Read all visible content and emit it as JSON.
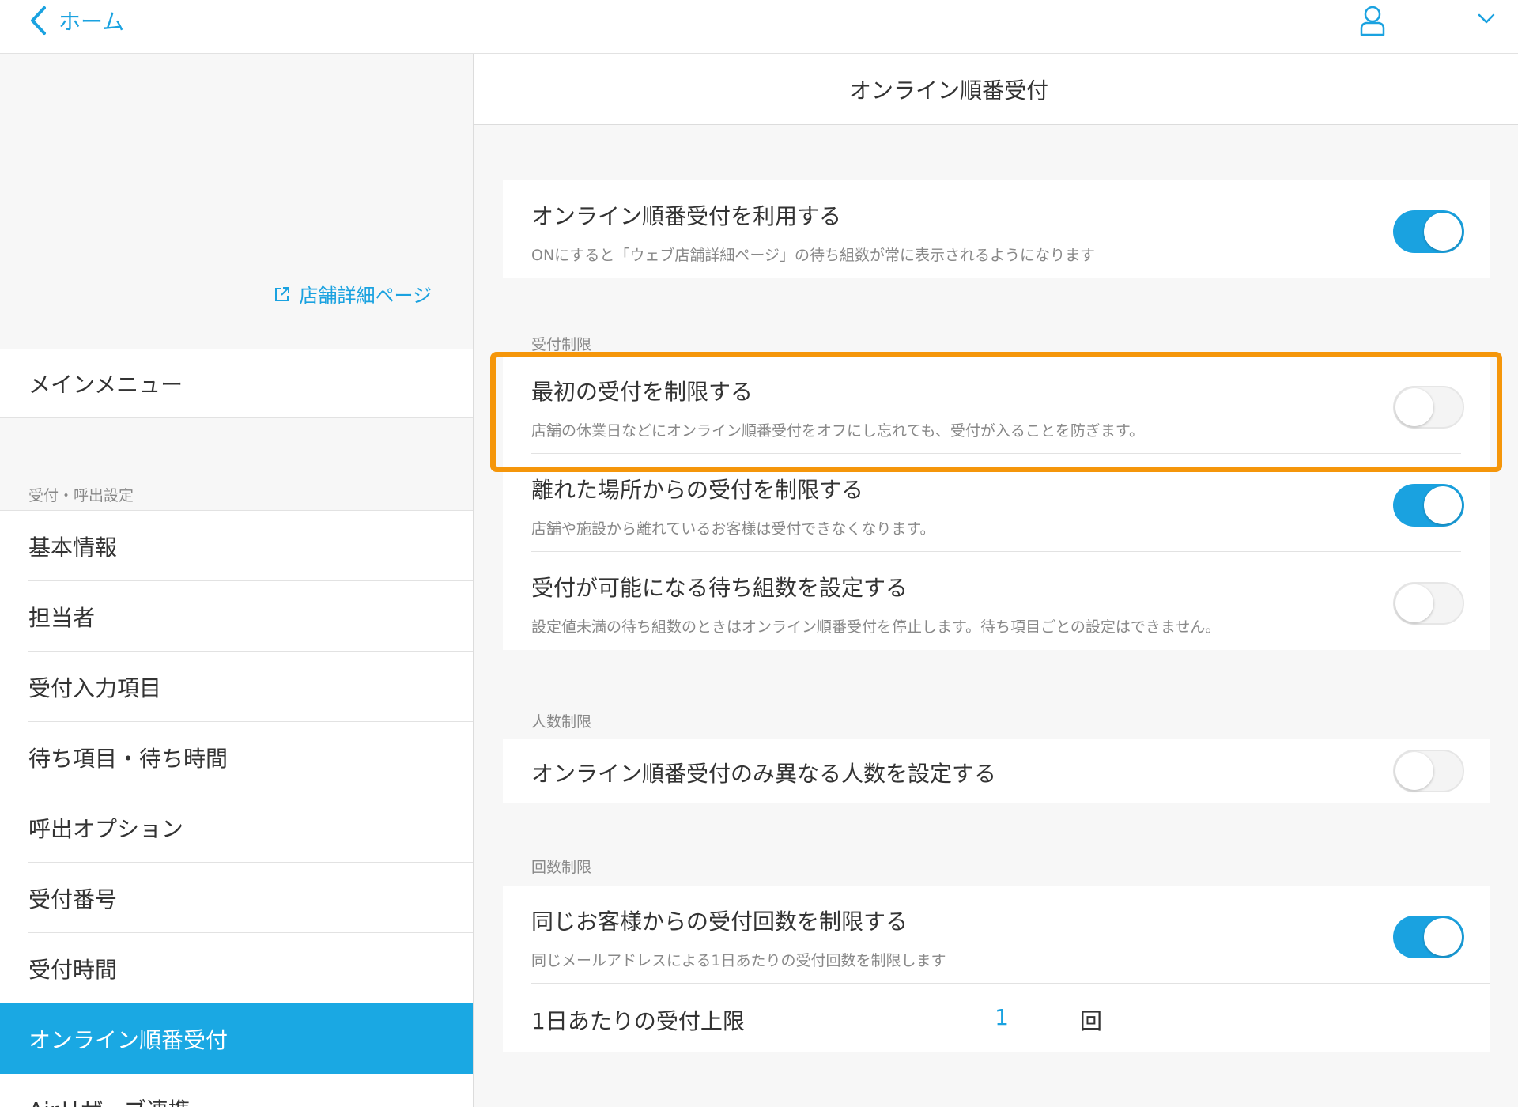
{
  "header": {
    "back_label": "ホーム"
  },
  "sidebar": {
    "store_link_label": "店舗詳細ページ",
    "main_menu_label": "メインメニュー",
    "section_label": "受付・呼出設定",
    "items": [
      {
        "label": "基本情報"
      },
      {
        "label": "担当者"
      },
      {
        "label": "受付入力項目"
      },
      {
        "label": "待ち項目・待ち時間"
      },
      {
        "label": "呼出オプション"
      },
      {
        "label": "受付番号"
      },
      {
        "label": "受付時間"
      },
      {
        "label": "オンライン順番受付"
      },
      {
        "label": "Airリザーブ連携"
      }
    ]
  },
  "main": {
    "title": "オンライン順番受付",
    "use_setting": {
      "title": "オンライン順番受付を利用する",
      "desc": "ONにすると「ウェブ店舗詳細ページ」の待ち組数が常に表示されるようになります",
      "enabled": true
    },
    "reception_limits": {
      "label": "受付制限",
      "rows": [
        {
          "title": "最初の受付を制限する",
          "desc": "店舗の休業日などにオンライン順番受付をオフにし忘れても、受付が入ることを防ぎます。",
          "enabled": false
        },
        {
          "title": "離れた場所からの受付を制限する",
          "desc": "店舗や施設から離れているお客様は受付できなくなります。",
          "enabled": true
        },
        {
          "title": "受付が可能になる待ち組数を設定する",
          "desc": "設定値未満の待ち組数のときはオンライン順番受付を停止します。待ち項目ごとの設定はできません。",
          "enabled": false
        }
      ]
    },
    "people_limit": {
      "label": "人数制限",
      "title": "オンライン順番受付のみ異なる人数を設定する",
      "enabled": false
    },
    "count_limit": {
      "label": "回数制限",
      "title": "同じお客様からの受付回数を制限する",
      "desc": "同じメールアドレスによる1日あたりの受付回数を制限します",
      "enabled": true,
      "per_day_label": "1日あたりの受付上限",
      "per_day_value": "1",
      "per_day_unit": "回"
    }
  },
  "colors": {
    "accent": "#1aa2e0",
    "highlight": "#f5960a"
  }
}
